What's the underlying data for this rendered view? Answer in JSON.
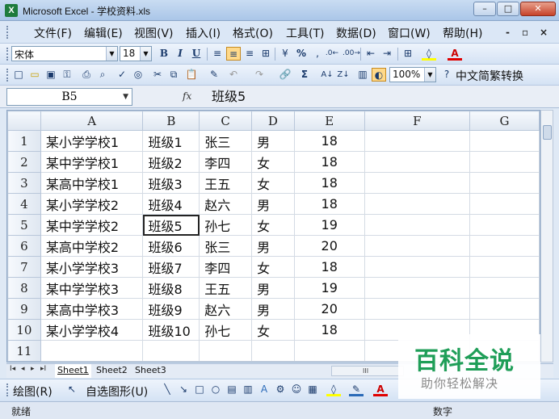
{
  "window": {
    "title": "Microsoft Excel - 学校资料.xls",
    "app_icon": "X",
    "controls": [
      "–",
      "□",
      "✕"
    ]
  },
  "menu": {
    "items": [
      "文件(F)",
      "编辑(E)",
      "视图(V)",
      "插入(I)",
      "格式(O)",
      "工具(T)",
      "数据(D)",
      "窗口(W)",
      "帮助(H)"
    ],
    "mdi_controls": [
      "-",
      "▫",
      "×"
    ]
  },
  "format_toolbar": {
    "font_name": "宋体",
    "font_size": "18",
    "bold": "B",
    "italic": "I",
    "underline": "U",
    "percent": "%"
  },
  "standard_toolbar": {
    "zoom": "100%",
    "sigma": "Σ",
    "addon": "中文简繁转换"
  },
  "formula_bar": {
    "name_box": "B5",
    "fx": "fx",
    "value": "班级5"
  },
  "sheet": {
    "columns": [
      "A",
      "B",
      "C",
      "D",
      "E",
      "F",
      "G"
    ],
    "rows": [
      {
        "num": "1",
        "cells": [
          "某小学学校1",
          "班级1",
          "张三",
          "男",
          "18"
        ]
      },
      {
        "num": "2",
        "cells": [
          "某中学学校1",
          "班级2",
          "李四",
          "女",
          "18"
        ]
      },
      {
        "num": "3",
        "cells": [
          "某高中学校1",
          "班级3",
          "王五",
          "女",
          "18"
        ]
      },
      {
        "num": "4",
        "cells": [
          "某小学学校2",
          "班级4",
          "赵六",
          "男",
          "18"
        ]
      },
      {
        "num": "5",
        "cells": [
          "某中学学校2",
          "班级5",
          "孙七",
          "女",
          "19"
        ]
      },
      {
        "num": "6",
        "cells": [
          "某高中学校2",
          "班级6",
          "张三",
          "男",
          "20"
        ]
      },
      {
        "num": "7",
        "cells": [
          "某小学学校3",
          "班级7",
          "李四",
          "女",
          "18"
        ]
      },
      {
        "num": "8",
        "cells": [
          "某中学学校3",
          "班级8",
          "王五",
          "男",
          "19"
        ]
      },
      {
        "num": "9",
        "cells": [
          "某高中学校3",
          "班级9",
          "赵六",
          "男",
          "20"
        ]
      },
      {
        "num": "10",
        "cells": [
          "某小学学校4",
          "班级10",
          "孙七",
          "女",
          "18"
        ]
      },
      {
        "num": "11",
        "cells": [
          "",
          "",
          "",
          "",
          ""
        ]
      }
    ],
    "selected_cell": "B5"
  },
  "sheet_tabs": {
    "nav": [
      "I◂",
      "◂",
      "▸",
      "▸I"
    ],
    "tabs": [
      "Sheet1",
      "Sheet2",
      "Sheet3"
    ],
    "active": "Sheet1",
    "scroll_mark": "III"
  },
  "drawing_toolbar": {
    "draw_label": "绘图(R)",
    "autoshape_label": "自选图形(U)"
  },
  "status": {
    "left": "就绪",
    "right": "数字"
  },
  "watermark": {
    "main": "百科全说",
    "sub": "助你轻松解决"
  },
  "colors": {
    "accent": "#1f9e58",
    "font_color": "#e00000",
    "highlight": "#ffff00"
  }
}
